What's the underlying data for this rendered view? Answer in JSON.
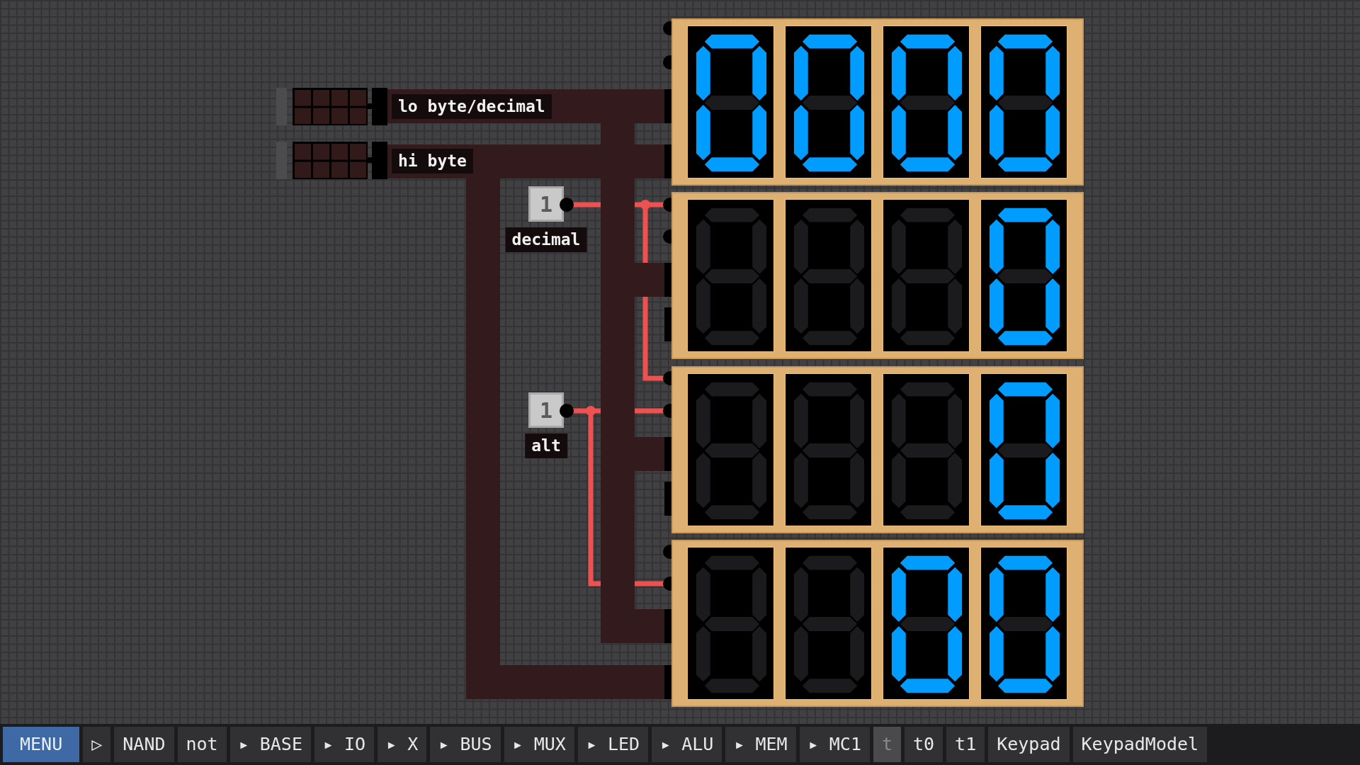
{
  "inputs": [
    {
      "label": "lo byte/decimal"
    },
    {
      "label": "hi byte"
    }
  ],
  "switches": [
    {
      "value": "1",
      "label": "decimal",
      "on": true
    },
    {
      "value": "1",
      "label": "alt",
      "on": true
    }
  ],
  "displays": [
    {
      "digits": [
        {
          "segments": [
            true,
            true,
            true,
            true,
            true,
            true,
            false
          ]
        },
        {
          "segments": [
            true,
            true,
            true,
            true,
            true,
            true,
            false
          ]
        },
        {
          "segments": [
            true,
            true,
            true,
            true,
            true,
            true,
            false
          ]
        },
        {
          "segments": [
            true,
            true,
            true,
            true,
            true,
            true,
            false
          ]
        }
      ]
    },
    {
      "digits": [
        {
          "segments": [
            false,
            false,
            false,
            false,
            false,
            false,
            false
          ]
        },
        {
          "segments": [
            false,
            false,
            false,
            false,
            false,
            false,
            false
          ]
        },
        {
          "segments": [
            false,
            false,
            false,
            false,
            false,
            false,
            false
          ]
        },
        {
          "segments": [
            true,
            true,
            true,
            true,
            true,
            true,
            false
          ]
        }
      ]
    },
    {
      "digits": [
        {
          "segments": [
            false,
            false,
            false,
            false,
            false,
            false,
            false
          ]
        },
        {
          "segments": [
            false,
            false,
            false,
            false,
            false,
            false,
            false
          ]
        },
        {
          "segments": [
            false,
            false,
            false,
            false,
            false,
            false,
            false
          ]
        },
        {
          "segments": [
            true,
            true,
            true,
            true,
            true,
            true,
            false
          ]
        }
      ]
    },
    {
      "digits": [
        {
          "segments": [
            false,
            false,
            false,
            false,
            false,
            false,
            false
          ]
        },
        {
          "segments": [
            false,
            false,
            false,
            false,
            false,
            false,
            false
          ]
        },
        {
          "segments": [
            true,
            true,
            true,
            true,
            true,
            true,
            false
          ]
        },
        {
          "segments": [
            true,
            true,
            true,
            true,
            true,
            true,
            false
          ]
        }
      ]
    }
  ],
  "toolbar": [
    {
      "label": "MENU",
      "selected": true,
      "disabled": false
    },
    {
      "label": "▷",
      "selected": false,
      "disabled": false
    },
    {
      "label": "NAND",
      "selected": false,
      "disabled": false
    },
    {
      "label": "not",
      "selected": false,
      "disabled": false
    },
    {
      "label": "▸ BASE",
      "selected": false,
      "disabled": false
    },
    {
      "label": "▸ IO",
      "selected": false,
      "disabled": false
    },
    {
      "label": "▸ X",
      "selected": false,
      "disabled": false
    },
    {
      "label": "▸ BUS",
      "selected": false,
      "disabled": false
    },
    {
      "label": "▸ MUX",
      "selected": false,
      "disabled": false
    },
    {
      "label": "▸ LED",
      "selected": false,
      "disabled": false
    },
    {
      "label": "▸ ALU",
      "selected": false,
      "disabled": false
    },
    {
      "label": "▸ MEM",
      "selected": false,
      "disabled": false
    },
    {
      "label": "▸ MC1",
      "selected": false,
      "disabled": false
    },
    {
      "label": "t",
      "selected": false,
      "disabled": true
    },
    {
      "label": "t0",
      "selected": false,
      "disabled": false
    },
    {
      "label": "t1",
      "selected": false,
      "disabled": false
    },
    {
      "label": "Keypad",
      "selected": false,
      "disabled": false
    },
    {
      "label": "KeypadModel",
      "selected": false,
      "disabled": false
    }
  ]
}
